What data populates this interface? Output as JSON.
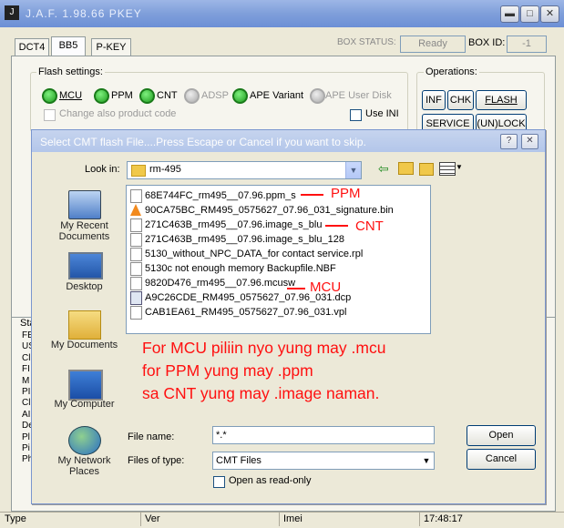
{
  "app": {
    "title": "J.A.F.  1.98.66 PKEY",
    "icon_glyph": "J",
    "window_controls": {
      "minimize": "▬",
      "maximize": "□",
      "close": "✕"
    },
    "tabs": [
      "DCT4",
      "BB5",
      "P-KEY"
    ],
    "box_status_label": "BOX STATUS:",
    "box_status_value": "Ready",
    "box_id_label": "BOX ID:",
    "box_id_value": "-1",
    "flash_settings_label": "Flash settings:",
    "flash_options": [
      {
        "label": "MCU",
        "active": true
      },
      {
        "label": "PPM",
        "active": true
      },
      {
        "label": "CNT",
        "active": true
      },
      {
        "label": "ADSP",
        "active": false
      },
      {
        "label": "APE Variant",
        "active": true
      },
      {
        "label": "APE User Disk",
        "active": false
      }
    ],
    "change_product_code": "Change also product code",
    "use_ini": "Use INI",
    "operations_label": "Operations:",
    "op_buttons": [
      "INF",
      "CHK",
      "FLASH",
      "SERVICE",
      "(UN)LOCK"
    ],
    "status_panel_label": "Sta",
    "status_letters": [
      "FE",
      "US",
      "Cl",
      "FI",
      "M",
      "PI",
      "Cl",
      "AI",
      "De",
      "Pl",
      "Pi",
      "Ph"
    ],
    "statusbar": {
      "type": "Type",
      "ver": "Ver",
      "imei": "Imei",
      "time": "17:48:17"
    }
  },
  "dialog": {
    "title": "Select CMT flash File....Press Escape or Cancel if you want to skip.",
    "help_btn": "?",
    "close_btn": "✕",
    "look_in_label": "Look in:",
    "look_in_value": "rm-495",
    "places": [
      "My Recent Documents",
      "Desktop",
      "My Documents",
      "My Computer",
      "My Network Places"
    ],
    "files": [
      {
        "name": "68E744FC_rm495__07.96.ppm_s",
        "type": "file"
      },
      {
        "name": "90CA75BC_RM495_0575627_07.96_031_signature.bin",
        "type": "bin"
      },
      {
        "name": "271C463B_rm495__07.96.image_s_blu",
        "type": "file"
      },
      {
        "name": "271C463B_rm495__07.96.image_s_blu_128",
        "type": "file"
      },
      {
        "name": "5130_without_NPC_DATA_for contact service.rpl",
        "type": "file"
      },
      {
        "name": "5130c not enough memory Backupfile.NBF",
        "type": "file"
      },
      {
        "name": "9820D476_rm495__07.96.mcusw",
        "type": "file"
      },
      {
        "name": "A9C26CDE_RM495_0575627_07.96_031.dcp",
        "type": "dcp"
      },
      {
        "name": "CAB1EA61_RM495_0575627_07.96_031.vpl",
        "type": "file"
      }
    ],
    "annotations": {
      "ppm": "PPM",
      "cnt": "CNT",
      "mcu": "MCU",
      "instructions": [
        "For MCU piliin nyo yung may .mcu",
        "for PPM yung may .ppm",
        "sa CNT yung may .image naman."
      ]
    },
    "file_name_label": "File name:",
    "file_name_value": "*.*",
    "files_of_type_label": "Files of type:",
    "files_of_type_value": "CMT Files",
    "open_readonly_label": "Open as read-only",
    "open_button": "Open",
    "cancel_button": "Cancel"
  }
}
